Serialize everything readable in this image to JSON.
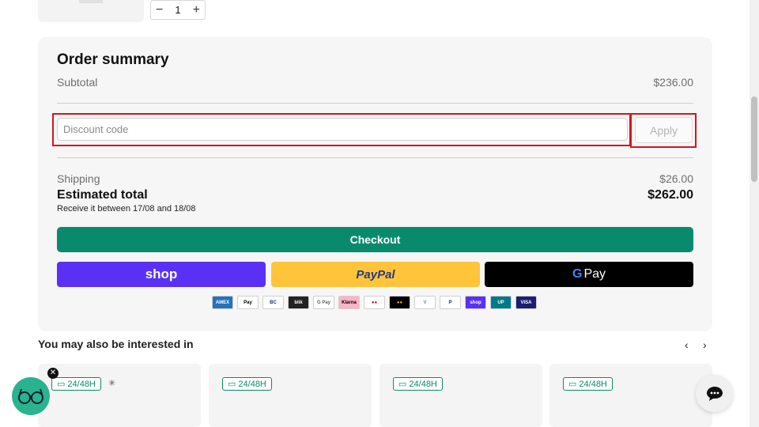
{
  "cart": {
    "quantity": "1",
    "minus": "−",
    "plus": "+"
  },
  "summary": {
    "title": "Order summary",
    "subtotal_label": "Subtotal",
    "subtotal_value": "$236.00",
    "discount_placeholder": "Discount code",
    "apply_label": "Apply",
    "shipping_label": "Shipping",
    "shipping_value": "$26.00",
    "total_label": "Estimated total",
    "total_value": "$262.00",
    "delivery_note": "Receive it between 17/08 and 18/08",
    "checkout_label": "Checkout",
    "shop_label": "shop",
    "paypal_label": "PayPal",
    "gpay_label": "Pay",
    "gpay_g": "G"
  },
  "payment_icons": [
    {
      "name": "amex-icon",
      "text": "AMEX",
      "bg": "#2671b9",
      "fg": "#ffffff"
    },
    {
      "name": "apple-pay-icon",
      "text": "Pay",
      "bg": "#ffffff",
      "fg": "#000000"
    },
    {
      "name": "bancontact-icon",
      "text": "BC",
      "bg": "#ffffff",
      "fg": "#1e3764"
    },
    {
      "name": "blik-icon",
      "text": "blik",
      "bg": "#222222",
      "fg": "#ffffff"
    },
    {
      "name": "google-pay-icon",
      "text": "G Pay",
      "bg": "#ffffff",
      "fg": "#5f6368"
    },
    {
      "name": "klarna-icon",
      "text": "Klarna",
      "bg": "#ffb3c7",
      "fg": "#000000"
    },
    {
      "name": "maestro-icon",
      "text": "●●",
      "bg": "#ffffff",
      "fg": "#e4002b"
    },
    {
      "name": "mastercard-icon",
      "text": "●●",
      "bg": "#000000",
      "fg": "#f79e1b"
    },
    {
      "name": "venmo-icon",
      "text": "V",
      "bg": "#ffffff",
      "fg": "#3d95ce"
    },
    {
      "name": "paypal-icon",
      "text": "P",
      "bg": "#ffffff",
      "fg": "#003087"
    },
    {
      "name": "shop-pay-icon",
      "text": "shop",
      "bg": "#5a31f4",
      "fg": "#ffffff"
    },
    {
      "name": "unionpay-icon",
      "text": "UP",
      "bg": "#01798a",
      "fg": "#ffffff"
    },
    {
      "name": "visa-icon",
      "text": "VISA",
      "bg": "#1a1f71",
      "fg": "#ffffff"
    }
  ],
  "recommendations": {
    "title": "You may also be interested in",
    "prev_icon": "‹",
    "next_icon": "›",
    "badge": "24/48H"
  },
  "colors": {
    "accent": "#0a8a6c",
    "highlight": "#d5141c"
  }
}
